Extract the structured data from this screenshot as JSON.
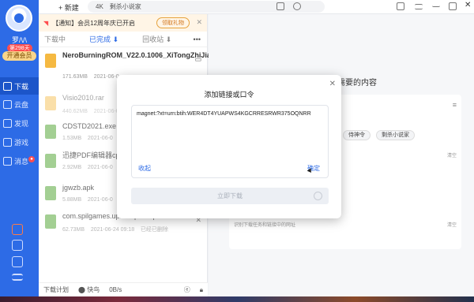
{
  "sidebar": {
    "username": "罗/\\/\\",
    "vip_tag": "第298天",
    "open_vip": "开通会员",
    "items": [
      {
        "label": "下载",
        "icon": "download-icon"
      },
      {
        "label": "云盘",
        "icon": "cloud-icon"
      },
      {
        "label": "发现",
        "icon": "discover-icon"
      },
      {
        "label": "游戏",
        "icon": "game-icon"
      },
      {
        "label": "消息",
        "icon": "message-icon"
      }
    ]
  },
  "topbar": {
    "new_label": "+ 新建",
    "search_quality": "4K",
    "search_text": "剩杀小说家"
  },
  "notice": {
    "text": "【通知】会员12周年庆已开启",
    "gift": "领取礼物"
  },
  "tabs": [
    "下载中",
    "已完成 ⬇",
    "回收站 ⬇"
  ],
  "files": [
    {
      "name": "NeroBurningROM_V22.0.1006_XiTongZhiJia.zip",
      "size": "171.63MB",
      "date": "2021-06-0"
    },
    {
      "name": "Visio2010.rar",
      "size": "440.62MB",
      "date": "2021-06-0"
    },
    {
      "name": "CDSTD2021.exe",
      "size": "1.53MB",
      "date": "2021-06-0"
    },
    {
      "name": "迅捷PDF编辑器cpc.exe",
      "size": "2.92MB",
      "date": "2021-06-0"
    },
    {
      "name": "jgwzb.apk",
      "size": "5.88MB",
      "date": "2021-06-0"
    },
    {
      "name": "com.spilgames.uphill.uphill.apk",
      "size": "62.73MB",
      "date": "2021-06-24 09:18",
      "status": "已经已删除"
    }
  ],
  "statusbar": {
    "plan": "下载计划",
    "turbo": "快鸟",
    "speed": "0B/s"
  },
  "right": {
    "title": "需要的内容",
    "tags": [
      "侍神令",
      "剩杀小说家"
    ],
    "clear1": "清空",
    "clear2": "清空",
    "empty_hint": "识别下载任务和链接中的网址"
  },
  "dialog": {
    "title": "添加链接或口令",
    "input_value": "magnet:?xt=urn:btih:WER4DT4YUAPWS4KGCRRESRWR375OQNRR",
    "collect": "收起",
    "confirm": "确定",
    "download": "立即下载"
  },
  "colors": {
    "accent": "#2d6be6",
    "sidebar_bg": "#2d6be6",
    "notice_bg": "#fff5e6"
  }
}
